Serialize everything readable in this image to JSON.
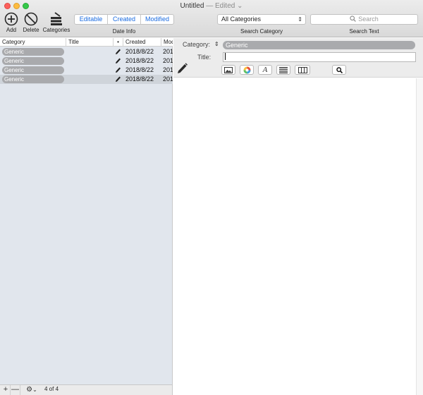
{
  "window": {
    "title": "Untitled",
    "edited": "— Edited",
    "edited_chevron": "chevron-down-icon"
  },
  "toolbar": {
    "add_label": "Add",
    "delete_label": "Delete",
    "categories_label": "Categories",
    "date_segments": [
      "Editable",
      "Created",
      "Modified"
    ],
    "date_caption": "Date Info",
    "category_select_value": "All Categories",
    "category_caption": "Search Category",
    "search_placeholder": "Search",
    "search_caption": "Search Text",
    "accent_color": "#1a6be0"
  },
  "list": {
    "columns": [
      "Category",
      "Title",
      "•",
      "Created",
      "Mod"
    ],
    "rows": [
      {
        "category": "Generic",
        "title": "",
        "editable_icon": "pencil-icon",
        "created": "2018/8/22",
        "modified": "201",
        "selected": false
      },
      {
        "category": "Generic",
        "title": "",
        "editable_icon": "pencil-icon",
        "created": "2018/8/22",
        "modified": "201",
        "selected": false
      },
      {
        "category": "Generic",
        "title": "",
        "editable_icon": "pencil-icon",
        "created": "2018/8/22",
        "modified": "201",
        "selected": false
      },
      {
        "category": "Generic",
        "title": "",
        "editable_icon": "pencil-icon",
        "created": "2018/8/22",
        "modified": "201",
        "selected": true
      }
    ]
  },
  "bottombar": {
    "add_symbol": "+",
    "remove_symbol": "—",
    "gear_symbol": "⚙",
    "gear_chevron": "⌄",
    "count": "4 of 4"
  },
  "editor": {
    "category_label": "Category:",
    "category_stepper": "⌃",
    "category_value": "Generic",
    "title_label": "Title:",
    "title_value": "",
    "tools": [
      "image-icon",
      "color-wheel-icon",
      "font-icon",
      "list-icon",
      "table-icon",
      "magnifier-icon"
    ],
    "pill_color": "#a9aaad"
  }
}
